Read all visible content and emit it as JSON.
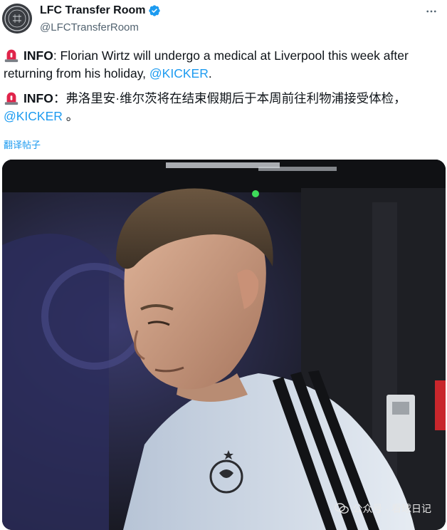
{
  "author": {
    "display_name": "LFC Transfer Room",
    "handle": "@LFCTransferRoom",
    "verified": true,
    "avatar_icon": "lfc-transfer-room-logo"
  },
  "tweet": {
    "paragraph1": {
      "label": "INFO",
      "sep": ": ",
      "text": "Florian Wirtz will undergo a medical at Liverpool this week after returning from his holiday, ",
      "mention": "@KICKER",
      "end": "."
    },
    "paragraph2": {
      "label": "INFO",
      "sep": "：",
      "text": "弗洛里安·维尔茨将在结束假期后于本周前往利物浦接受体检，",
      "mention": "@KICKER",
      "end": " 。"
    },
    "translate_label": "翻译帖子"
  },
  "media": {
    "watermark_text": "公众号 · 看球日记"
  },
  "colors": {
    "accent": "#1d9bf0",
    "text": "#0f1419",
    "muted": "#536471",
    "siren": "#e0244a"
  },
  "icons": [
    "siren-emoji",
    "verified-badge-icon",
    "more-options-icon",
    "wechat-icon"
  ]
}
